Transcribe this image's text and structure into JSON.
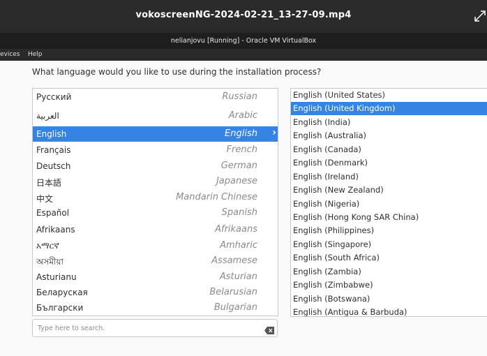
{
  "window": {
    "title": "vokoscreenNG-2024-02-21_13-27-09.mp4"
  },
  "vm": {
    "title": "nelianjovu [Running] - Oracle VM VirtualBox"
  },
  "menubar": {
    "items": [
      "evices",
      "Help"
    ]
  },
  "installer": {
    "question": "What language would you like to use during the installation process?",
    "languages": [
      {
        "native": "Русский",
        "english": "Russian"
      },
      {
        "native": "العربية",
        "english": "Arabic"
      },
      {
        "native": "English",
        "english": "English",
        "selected": true
      },
      {
        "native": "Français",
        "english": "French"
      },
      {
        "native": "Deutsch",
        "english": "German"
      },
      {
        "native": "日本語",
        "english": "Japanese"
      },
      {
        "native": "中文",
        "english": "Mandarin Chinese"
      },
      {
        "native": "Español",
        "english": "Spanish"
      },
      {
        "native": "Afrikaans",
        "english": "Afrikaans"
      },
      {
        "native": "አማርኛ",
        "english": "Amharic"
      },
      {
        "native": "অসমীয়া",
        "english": "Assamese"
      },
      {
        "native": "Asturianu",
        "english": "Asturian"
      },
      {
        "native": "Беларуская",
        "english": "Belarusian"
      },
      {
        "native": "Български",
        "english": "Bulgarian"
      }
    ],
    "search": {
      "placeholder": "Type here to search."
    },
    "locales": [
      {
        "label": "English (United States)"
      },
      {
        "label": "English (United Kingdom)",
        "selected": true
      },
      {
        "label": "English (India)"
      },
      {
        "label": "English (Australia)"
      },
      {
        "label": "English (Canada)"
      },
      {
        "label": "English (Denmark)"
      },
      {
        "label": "English (Ireland)"
      },
      {
        "label": "English (New Zealand)"
      },
      {
        "label": "English (Nigeria)"
      },
      {
        "label": "English (Hong Kong SAR China)"
      },
      {
        "label": "English (Philippines)"
      },
      {
        "label": "English (Singapore)"
      },
      {
        "label": "English (South Africa)"
      },
      {
        "label": "English (Zambia)"
      },
      {
        "label": "English (Zimbabwe)"
      },
      {
        "label": "English (Botswana)"
      },
      {
        "label": "English (Antigua & Barbuda)"
      }
    ]
  },
  "colors": {
    "accent": "#3584e4",
    "topbar": "#2b2b2b"
  },
  "icons": {
    "expand": "expand-icon",
    "arrow": "chevron-right-icon",
    "clear": "clear-search-icon"
  }
}
